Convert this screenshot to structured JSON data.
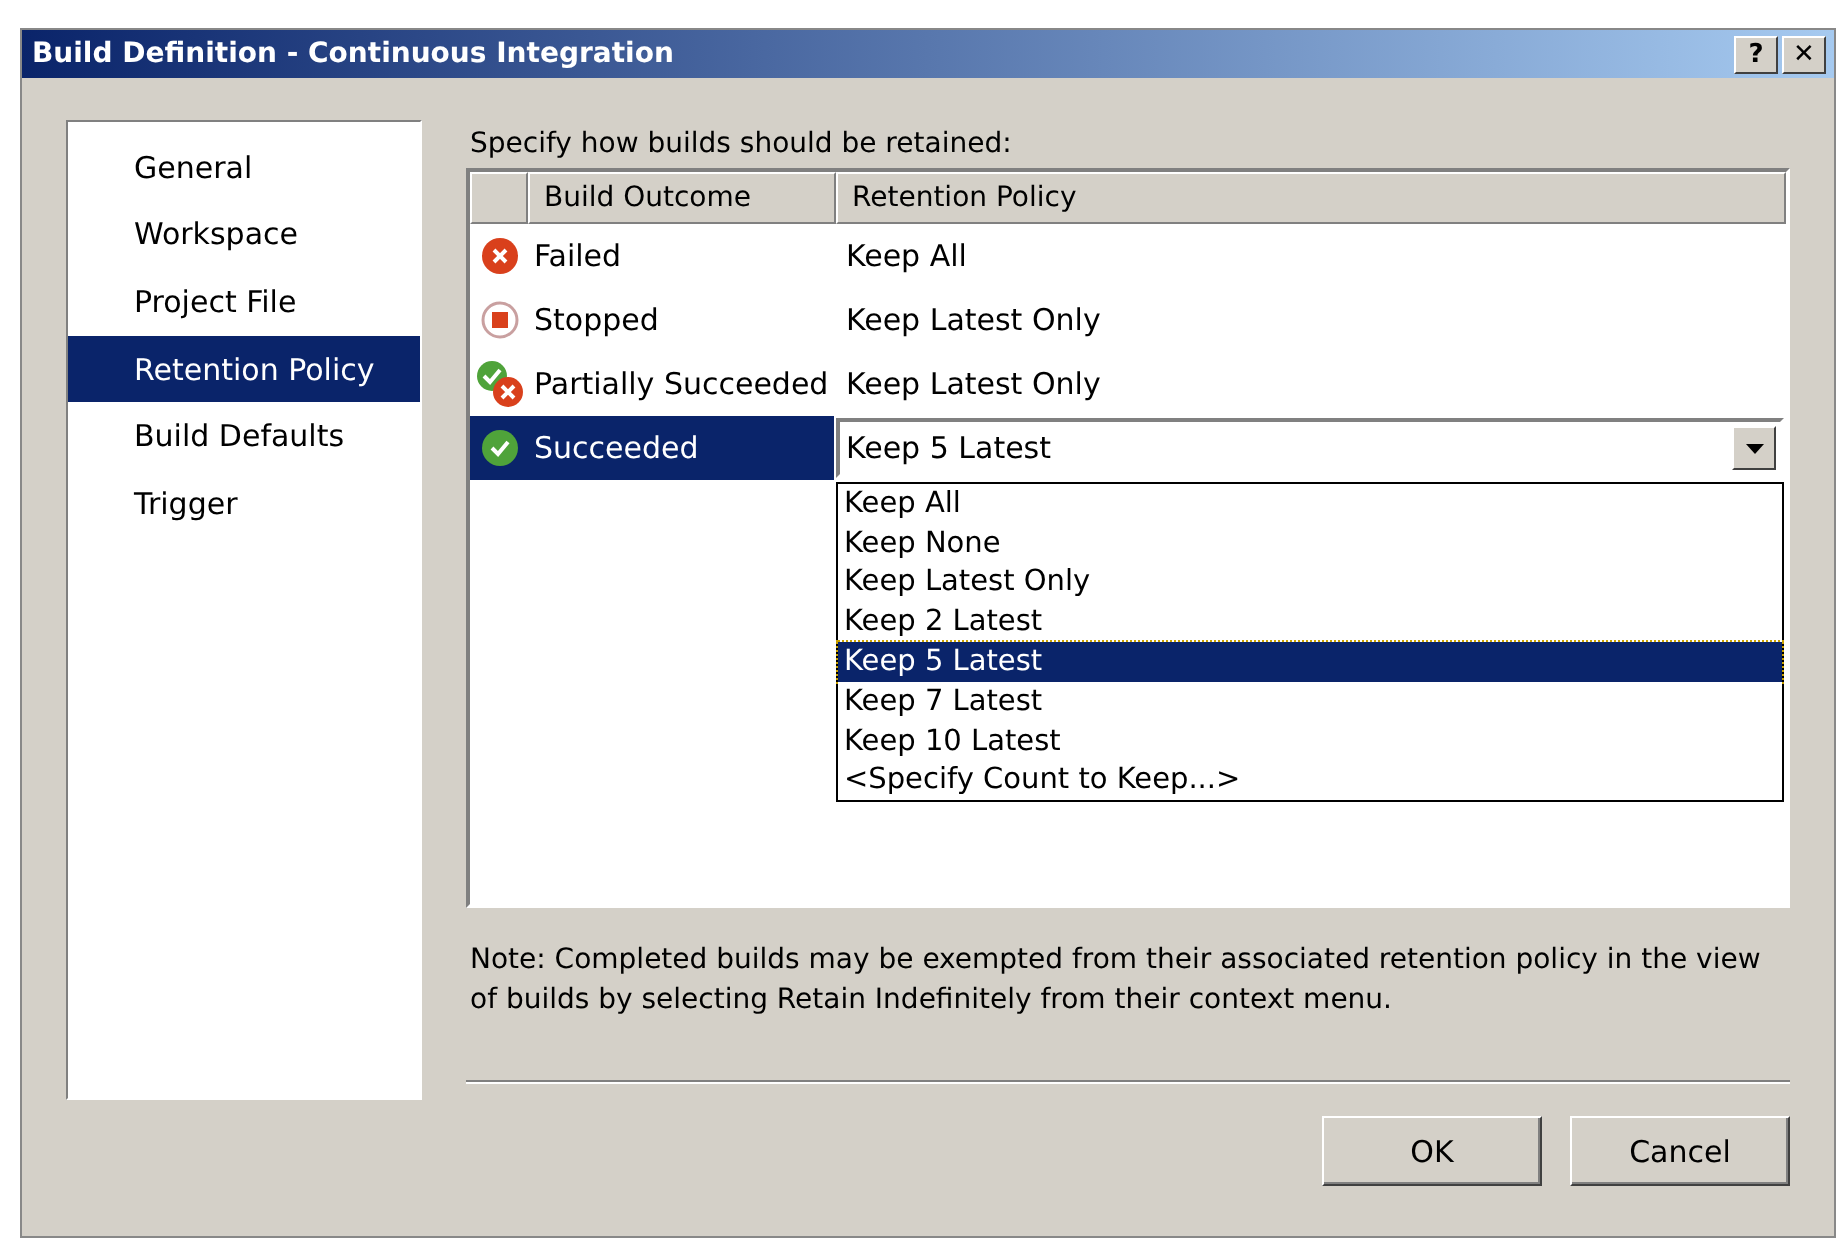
{
  "window": {
    "title": "Build Definition - Continuous Integration",
    "buttons": [
      "?",
      "✕"
    ]
  },
  "sidebar": {
    "items": [
      {
        "label": "General",
        "selected": false
      },
      {
        "label": "Workspace",
        "selected": false
      },
      {
        "label": "Project File",
        "selected": false
      },
      {
        "label": "Retention Policy",
        "selected": true
      },
      {
        "label": "Build Defaults",
        "selected": false
      },
      {
        "label": "Trigger",
        "selected": false
      }
    ]
  },
  "instruction": "Specify how builds should be retained:",
  "table": {
    "columns": [
      "Build Outcome",
      "Retention Policy"
    ],
    "rows": [
      {
        "kind": "failed",
        "outcome": "Failed",
        "policy": "Keep All",
        "selected": false
      },
      {
        "kind": "stopped",
        "outcome": "Stopped",
        "policy": "Keep Latest Only",
        "selected": false
      },
      {
        "kind": "partial",
        "outcome": "Partially Succeeded",
        "policy": "Keep Latest Only",
        "selected": false
      },
      {
        "kind": "succeeded",
        "outcome": "Succeeded",
        "policy": "Keep 5 Latest",
        "selected": true
      }
    ]
  },
  "dropdown": {
    "options": [
      {
        "label": "Keep All",
        "selected": false
      },
      {
        "label": "Keep None",
        "selected": false
      },
      {
        "label": "Keep Latest Only",
        "selected": false
      },
      {
        "label": "Keep 2 Latest",
        "selected": false
      },
      {
        "label": "Keep 5 Latest",
        "selected": true
      },
      {
        "label": "Keep 7 Latest",
        "selected": false
      },
      {
        "label": "Keep 10 Latest",
        "selected": false
      },
      {
        "label": "<Specify Count to Keep...>",
        "selected": false
      }
    ]
  },
  "note": "Note: Completed builds may be exempted from their associated retention policy in the view of builds by selecting Retain Indefinitely from their context menu.",
  "buttons": [
    "OK",
    "Cancel"
  ]
}
